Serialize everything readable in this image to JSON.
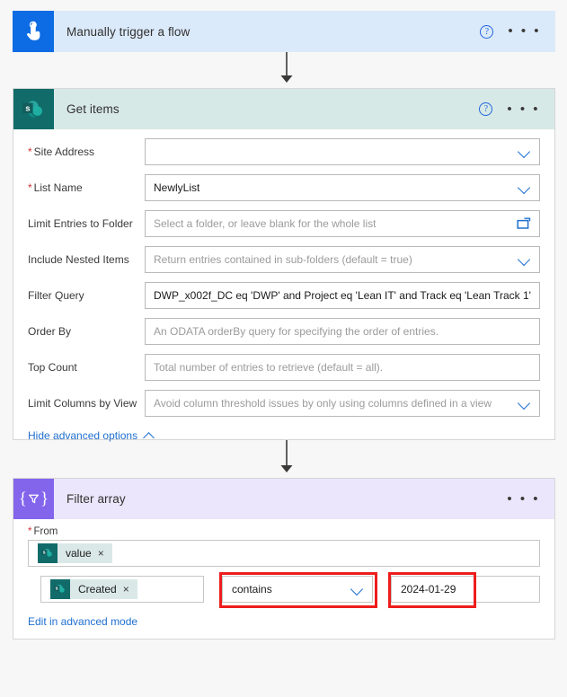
{
  "trigger": {
    "title": "Manually trigger a flow",
    "icon": "tap-hand-icon",
    "help_label": "?",
    "menu_label": "• • •",
    "accent": "#0d6ce4",
    "header_bg": "#dbeafa"
  },
  "get_items": {
    "title": "Get items",
    "icon": "sharepoint-icon",
    "help_label": "?",
    "menu_label": "• • •",
    "accent": "#106b69",
    "header_bg": "#d7e9e7",
    "fields": [
      {
        "label": "Site Address",
        "required": true,
        "value": "",
        "placeholder": "",
        "redacted": true,
        "control": "dropdown"
      },
      {
        "label": "List Name",
        "required": true,
        "value": "NewlyList",
        "placeholder": "",
        "redacted": false,
        "control": "dropdown"
      },
      {
        "label": "Limit Entries to Folder",
        "required": false,
        "value": "",
        "placeholder": "Select a folder, or leave blank for the whole list",
        "redacted": false,
        "control": "folder"
      },
      {
        "label": "Include Nested Items",
        "required": false,
        "value": "",
        "placeholder": "Return entries contained in sub-folders (default = true)",
        "redacted": false,
        "control": "dropdown"
      },
      {
        "label": "Filter Query",
        "required": false,
        "value": "DWP_x002f_DC eq 'DWP' and Project eq 'Lean IT' and Track eq 'Lean Track 1'",
        "placeholder": "",
        "redacted": false,
        "control": "text"
      },
      {
        "label": "Order By",
        "required": false,
        "value": "",
        "placeholder": "An ODATA orderBy query for specifying the order of entries.",
        "redacted": false,
        "control": "text"
      },
      {
        "label": "Top Count",
        "required": false,
        "value": "",
        "placeholder": "Total number of entries to retrieve (default = all).",
        "redacted": false,
        "control": "text"
      },
      {
        "label": "Limit Columns by View",
        "required": false,
        "value": "",
        "placeholder": "Avoid column threshold issues by only using columns defined in a view",
        "redacted": false,
        "control": "dropdown"
      }
    ],
    "advanced_link": "Hide advanced options"
  },
  "filter_array": {
    "title": "Filter array",
    "icon": "filter-array-icon",
    "menu_label": "• • •",
    "accent": "#8365ec",
    "header_bg": "#ebe6fb",
    "from_label": "From",
    "from_required": true,
    "from_token": "value",
    "token_remove": "×",
    "condition": {
      "property_token": "Created",
      "operator": "contains",
      "value": "2024-01-29"
    },
    "advanced_mode_link": "Edit in advanced mode",
    "highlight_color": "#ee1d1d"
  }
}
